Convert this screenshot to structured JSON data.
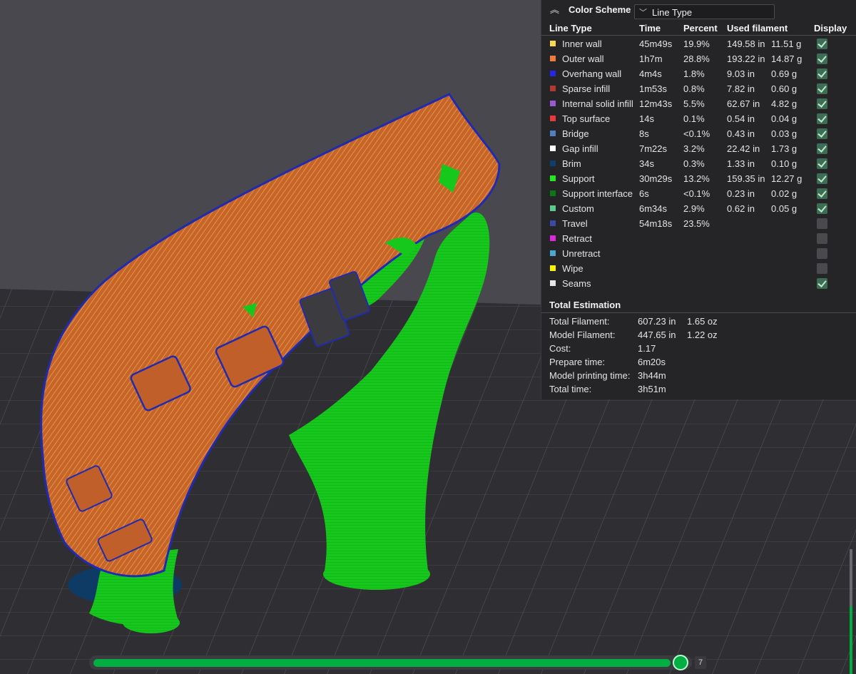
{
  "color_scheme": {
    "title": "Color Scheme",
    "collapse_icon": "double-chevron-up-icon",
    "dropdown_icon": "chevron-down-icon",
    "selected": "Line Type"
  },
  "table": {
    "headers": {
      "line_type": "Line Type",
      "time": "Time",
      "percent": "Percent",
      "used_filament": "Used filament",
      "display": "Display"
    },
    "rows": [
      {
        "name": "Inner wall",
        "color": "#f5d94a",
        "time": "45m49s",
        "percent": "19.9%",
        "length": "149.58 in",
        "weight": "11.51 g",
        "display": true
      },
      {
        "name": "Outer wall",
        "color": "#f07a3a",
        "time": "1h7m",
        "percent": "28.8%",
        "length": "193.22 in",
        "weight": "14.87 g",
        "display": true
      },
      {
        "name": "Overhang wall",
        "color": "#2626e8",
        "time": "4m4s",
        "percent": "1.8%",
        "length": "9.03 in",
        "weight": "0.69 g",
        "display": true
      },
      {
        "name": "Sparse infill",
        "color": "#b03a2e",
        "time": "1m53s",
        "percent": "0.8%",
        "length": "7.82 in",
        "weight": "0.60 g",
        "display": true
      },
      {
        "name": "Internal solid infill",
        "color": "#9b59d0",
        "time": "12m43s",
        "percent": "5.5%",
        "length": "62.67 in",
        "weight": "4.82 g",
        "display": true
      },
      {
        "name": "Top surface",
        "color": "#e83a3a",
        "time": "14s",
        "percent": "0.1%",
        "length": "0.54 in",
        "weight": "0.04 g",
        "display": true
      },
      {
        "name": "Bridge",
        "color": "#4f7fbf",
        "time": "8s",
        "percent": "<0.1%",
        "length": "0.43 in",
        "weight": "0.03 g",
        "display": true
      },
      {
        "name": "Gap infill",
        "color": "#ffffff",
        "time": "7m22s",
        "percent": "3.2%",
        "length": "22.42 in",
        "weight": "1.73 g",
        "display": true
      },
      {
        "name": "Brim",
        "color": "#0d3f6e",
        "time": "34s",
        "percent": "0.3%",
        "length": "1.33 in",
        "weight": "0.10 g",
        "display": true
      },
      {
        "name": "Support",
        "color": "#22e81e",
        "time": "30m29s",
        "percent": "13.2%",
        "length": "159.35 in",
        "weight": "12.27 g",
        "display": true
      },
      {
        "name": "Support interface",
        "color": "#0a7a10",
        "time": "6s",
        "percent": "<0.1%",
        "length": "0.23 in",
        "weight": "0.02 g",
        "display": true
      },
      {
        "name": "Custom",
        "color": "#5ec98f",
        "time": "6m34s",
        "percent": "2.9%",
        "length": "0.62 in",
        "weight": "0.05 g",
        "display": true
      },
      {
        "name": "Travel",
        "color": "#3b4aa6",
        "time": "54m18s",
        "percent": "23.5%",
        "length": "",
        "weight": "",
        "display": false
      },
      {
        "name": "Retract",
        "color": "#d82ad8",
        "time": "",
        "percent": "",
        "length": "",
        "weight": "",
        "display": false
      },
      {
        "name": "Unretract",
        "color": "#4aa8d0",
        "time": "",
        "percent": "",
        "length": "",
        "weight": "",
        "display": false
      },
      {
        "name": "Wipe",
        "color": "#f5f500",
        "time": "",
        "percent": "",
        "length": "",
        "weight": "",
        "display": false
      },
      {
        "name": "Seams",
        "color": "#e6e6e6",
        "time": "",
        "percent": "",
        "length": "",
        "weight": "",
        "display": true
      }
    ]
  },
  "total_estimation": {
    "title": "Total Estimation",
    "rows": [
      {
        "label": "Total Filament:",
        "v1": "607.23 in",
        "v2": "1.65 oz"
      },
      {
        "label": "Model Filament:",
        "v1": "447.65 in",
        "v2": "1.22 oz"
      },
      {
        "label": "Cost:",
        "v1": "1.17",
        "v2": ""
      },
      {
        "label": "Prepare time:",
        "v1": "6m20s",
        "v2": ""
      },
      {
        "label": "Model printing time:",
        "v1": "3h44m",
        "v2": ""
      },
      {
        "label": "Total time:",
        "v1": "3h51m",
        "v2": ""
      }
    ]
  },
  "layer_slider": {
    "value": "7",
    "progress": 0.98
  },
  "colors": {
    "accent": "#00ae42",
    "panel_bg": "#252528",
    "background": "#4a4a50",
    "plate": "#2f2f33",
    "model": "#c8642a",
    "support": "#22c81e"
  }
}
